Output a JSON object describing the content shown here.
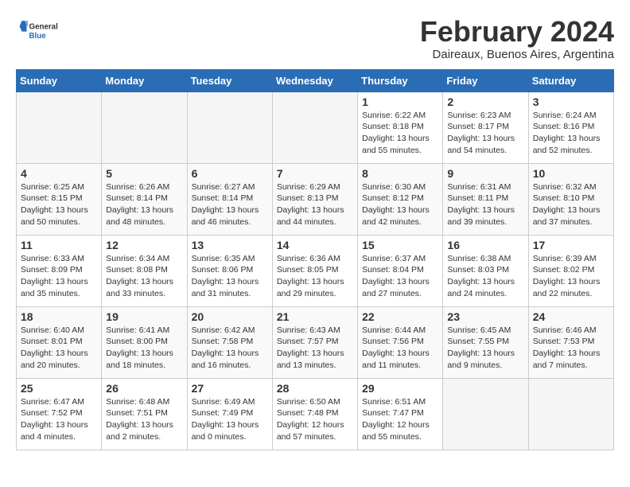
{
  "header": {
    "logo_general": "General",
    "logo_blue": "Blue",
    "month_title": "February 2024",
    "location": "Daireaux, Buenos Aires, Argentina"
  },
  "weekdays": [
    "Sunday",
    "Monday",
    "Tuesday",
    "Wednesday",
    "Thursday",
    "Friday",
    "Saturday"
  ],
  "weeks": [
    [
      {
        "day": "",
        "info": ""
      },
      {
        "day": "",
        "info": ""
      },
      {
        "day": "",
        "info": ""
      },
      {
        "day": "",
        "info": ""
      },
      {
        "day": "1",
        "info": "Sunrise: 6:22 AM\nSunset: 8:18 PM\nDaylight: 13 hours\nand 55 minutes."
      },
      {
        "day": "2",
        "info": "Sunrise: 6:23 AM\nSunset: 8:17 PM\nDaylight: 13 hours\nand 54 minutes."
      },
      {
        "day": "3",
        "info": "Sunrise: 6:24 AM\nSunset: 8:16 PM\nDaylight: 13 hours\nand 52 minutes."
      }
    ],
    [
      {
        "day": "4",
        "info": "Sunrise: 6:25 AM\nSunset: 8:15 PM\nDaylight: 13 hours\nand 50 minutes."
      },
      {
        "day": "5",
        "info": "Sunrise: 6:26 AM\nSunset: 8:14 PM\nDaylight: 13 hours\nand 48 minutes."
      },
      {
        "day": "6",
        "info": "Sunrise: 6:27 AM\nSunset: 8:14 PM\nDaylight: 13 hours\nand 46 minutes."
      },
      {
        "day": "7",
        "info": "Sunrise: 6:29 AM\nSunset: 8:13 PM\nDaylight: 13 hours\nand 44 minutes."
      },
      {
        "day": "8",
        "info": "Sunrise: 6:30 AM\nSunset: 8:12 PM\nDaylight: 13 hours\nand 42 minutes."
      },
      {
        "day": "9",
        "info": "Sunrise: 6:31 AM\nSunset: 8:11 PM\nDaylight: 13 hours\nand 39 minutes."
      },
      {
        "day": "10",
        "info": "Sunrise: 6:32 AM\nSunset: 8:10 PM\nDaylight: 13 hours\nand 37 minutes."
      }
    ],
    [
      {
        "day": "11",
        "info": "Sunrise: 6:33 AM\nSunset: 8:09 PM\nDaylight: 13 hours\nand 35 minutes."
      },
      {
        "day": "12",
        "info": "Sunrise: 6:34 AM\nSunset: 8:08 PM\nDaylight: 13 hours\nand 33 minutes."
      },
      {
        "day": "13",
        "info": "Sunrise: 6:35 AM\nSunset: 8:06 PM\nDaylight: 13 hours\nand 31 minutes."
      },
      {
        "day": "14",
        "info": "Sunrise: 6:36 AM\nSunset: 8:05 PM\nDaylight: 13 hours\nand 29 minutes."
      },
      {
        "day": "15",
        "info": "Sunrise: 6:37 AM\nSunset: 8:04 PM\nDaylight: 13 hours\nand 27 minutes."
      },
      {
        "day": "16",
        "info": "Sunrise: 6:38 AM\nSunset: 8:03 PM\nDaylight: 13 hours\nand 24 minutes."
      },
      {
        "day": "17",
        "info": "Sunrise: 6:39 AM\nSunset: 8:02 PM\nDaylight: 13 hours\nand 22 minutes."
      }
    ],
    [
      {
        "day": "18",
        "info": "Sunrise: 6:40 AM\nSunset: 8:01 PM\nDaylight: 13 hours\nand 20 minutes."
      },
      {
        "day": "19",
        "info": "Sunrise: 6:41 AM\nSunset: 8:00 PM\nDaylight: 13 hours\nand 18 minutes."
      },
      {
        "day": "20",
        "info": "Sunrise: 6:42 AM\nSunset: 7:58 PM\nDaylight: 13 hours\nand 16 minutes."
      },
      {
        "day": "21",
        "info": "Sunrise: 6:43 AM\nSunset: 7:57 PM\nDaylight: 13 hours\nand 13 minutes."
      },
      {
        "day": "22",
        "info": "Sunrise: 6:44 AM\nSunset: 7:56 PM\nDaylight: 13 hours\nand 11 minutes."
      },
      {
        "day": "23",
        "info": "Sunrise: 6:45 AM\nSunset: 7:55 PM\nDaylight: 13 hours\nand 9 minutes."
      },
      {
        "day": "24",
        "info": "Sunrise: 6:46 AM\nSunset: 7:53 PM\nDaylight: 13 hours\nand 7 minutes."
      }
    ],
    [
      {
        "day": "25",
        "info": "Sunrise: 6:47 AM\nSunset: 7:52 PM\nDaylight: 13 hours\nand 4 minutes."
      },
      {
        "day": "26",
        "info": "Sunrise: 6:48 AM\nSunset: 7:51 PM\nDaylight: 13 hours\nand 2 minutes."
      },
      {
        "day": "27",
        "info": "Sunrise: 6:49 AM\nSunset: 7:49 PM\nDaylight: 13 hours\nand 0 minutes."
      },
      {
        "day": "28",
        "info": "Sunrise: 6:50 AM\nSunset: 7:48 PM\nDaylight: 12 hours\nand 57 minutes."
      },
      {
        "day": "29",
        "info": "Sunrise: 6:51 AM\nSunset: 7:47 PM\nDaylight: 12 hours\nand 55 minutes."
      },
      {
        "day": "",
        "info": ""
      },
      {
        "day": "",
        "info": ""
      }
    ]
  ]
}
